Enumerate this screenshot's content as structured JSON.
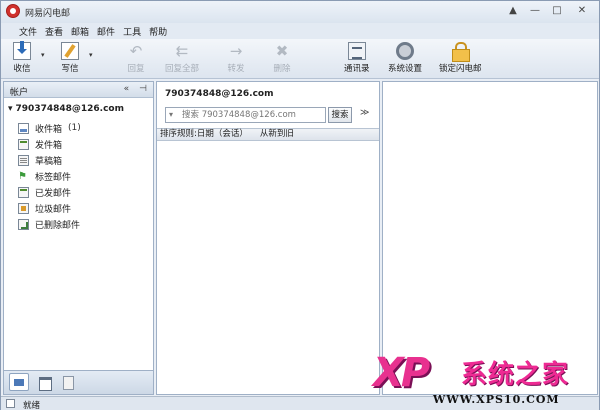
{
  "window": {
    "title": "网易闪电邮",
    "controls": [
      "▲",
      "—",
      "□",
      "✕"
    ]
  },
  "menu": [
    "文件",
    "查看",
    "邮箱",
    "邮件",
    "工具",
    "帮助"
  ],
  "toolbar": {
    "receive": "收信",
    "write": "写信",
    "reply": "回复",
    "reply_all": "回复全部",
    "forward": "转发",
    "delete": "删除",
    "contacts": "通讯录",
    "settings": "系统设置",
    "lock": "锁定闪电邮"
  },
  "left_pane": {
    "header": "帐户",
    "header_buttons": [
      "«",
      "⊣"
    ],
    "account": "790374848@126.com",
    "folders": [
      {
        "label": "收件箱",
        "count": "(1)"
      },
      {
        "label": "发件箱",
        "count": ""
      },
      {
        "label": "草稿箱",
        "count": ""
      },
      {
        "label": "标签邮件",
        "count": ""
      },
      {
        "label": "已发邮件",
        "count": ""
      },
      {
        "label": "垃圾邮件",
        "count": ""
      },
      {
        "label": "已删除邮件",
        "count": ""
      }
    ]
  },
  "mid_pane": {
    "account": "790374848@126.com",
    "search_placeholder": "搜索 790374848@126.com",
    "search_button": "搜索",
    "expand": "≫",
    "sort_rule": "排序规则:日期（会话）",
    "sort_order": "从新到旧"
  },
  "status": {
    "text": "就绪"
  },
  "watermark": {
    "logo": "XP",
    "name": "系统之家",
    "url": "WWW.XPS10.COM"
  }
}
